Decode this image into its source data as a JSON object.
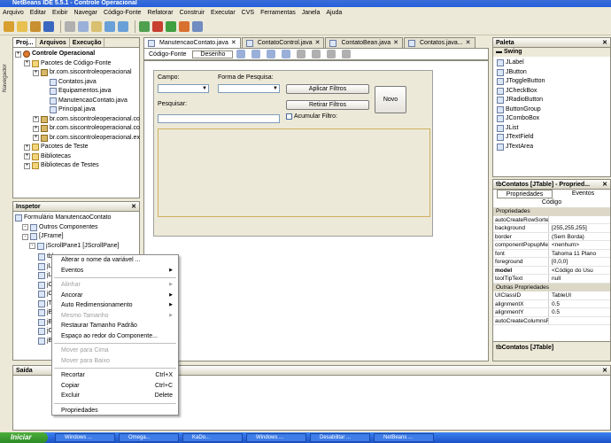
{
  "window": {
    "title": "NetBeans IDE 5.5.1 - Controle Operacional"
  },
  "menu": [
    "Arquivo",
    "Editar",
    "Exibir",
    "Navegar",
    "Código-Fonte",
    "Refatorar",
    "Construir",
    "Executar",
    "CVS",
    "Ferramentas",
    "Janela",
    "Ajuda"
  ],
  "left_tabs": [
    "Proj...",
    "Arquivos",
    "Execução"
  ],
  "navigator_label": "Navegador",
  "project_tree": [
    {
      "label": "Controle Operacional",
      "level": 0,
      "icon": "proj",
      "bold": true
    },
    {
      "label": "Pacotes de Código-Fonte",
      "level": 1,
      "icon": "fold"
    },
    {
      "label": "br.com.siscontroleoperacional",
      "level": 2,
      "icon": "pkg"
    },
    {
      "label": "Contatos.java",
      "level": 3,
      "icon": "file"
    },
    {
      "label": "Equipamentos.java",
      "level": 3,
      "icon": "file"
    },
    {
      "label": "ManutencaoContato.java",
      "level": 3,
      "icon": "file"
    },
    {
      "label": "Principal.java",
      "level": 3,
      "icon": "file"
    },
    {
      "label": "br.com.siscontroleoperacional.co",
      "level": 2,
      "icon": "pkg"
    },
    {
      "label": "br.com.siscontroleoperacional.co",
      "level": 2,
      "icon": "pkg"
    },
    {
      "label": "br.com.siscontroleoperacional.ex",
      "level": 2,
      "icon": "pkg"
    },
    {
      "label": "Pacotes de Teste",
      "level": 1,
      "icon": "fold"
    },
    {
      "label": "Bibliotecas",
      "level": 1,
      "icon": "fold"
    },
    {
      "label": "Bibliotecas de Testes",
      "level": 1,
      "icon": "fold"
    }
  ],
  "inspector": {
    "title": "Inspetor",
    "items": [
      {
        "label": "Formulário ManutencaoContato",
        "level": 0
      },
      {
        "label": "Outros Componentes",
        "level": 1
      },
      {
        "label": "[JFrame]",
        "level": 1
      },
      {
        "label": "jScrollPane1 [JScrollPane]",
        "level": 2
      }
    ]
  },
  "editor_tabs": [
    "ManutencaoContato.java",
    "ContatoControl.java",
    "ContatoBean.java",
    "Contatos.java..."
  ],
  "editor_mode": {
    "source": "Código-Fonte",
    "design": "Desenho"
  },
  "form": {
    "campo_label": "Campo:",
    "forma_label": "Forma de Pesquisa:",
    "pesquisar_label": "Pesquisar:",
    "aplicar": "Aplicar Filtros",
    "retirar": "Retirar Filtros",
    "novo": "Novo",
    "acumular": "Acumular Filtro:"
  },
  "context_menu": [
    {
      "label": "Alterar o nome da variável ...",
      "enabled": true
    },
    {
      "label": "Eventos",
      "enabled": true,
      "submenu": true
    },
    {
      "sep": true
    },
    {
      "label": "Alinhar",
      "enabled": false,
      "submenu": true
    },
    {
      "label": "Ancorar",
      "enabled": true,
      "submenu": true
    },
    {
      "label": "Auto Redimensionamento",
      "enabled": true,
      "submenu": true
    },
    {
      "label": "Mesmo Tamanho",
      "enabled": false,
      "submenu": true
    },
    {
      "label": "Restaurar Tamanho Padrão",
      "enabled": true
    },
    {
      "label": "Espaço ao redor do Componente...",
      "enabled": true
    },
    {
      "sep": true
    },
    {
      "label": "Mover para Cima",
      "enabled": false
    },
    {
      "label": "Mover para Baixo",
      "enabled": false
    },
    {
      "sep": true
    },
    {
      "label": "Recortar",
      "shortcut": "Ctrl+X",
      "enabled": true
    },
    {
      "label": "Copiar",
      "shortcut": "Ctrl+C",
      "enabled": true
    },
    {
      "label": "Excluir",
      "shortcut": "Delete",
      "enabled": true
    },
    {
      "sep": true
    },
    {
      "label": "Propriedades",
      "enabled": true
    }
  ],
  "palette": {
    "title": "Paleta",
    "category": "Swing",
    "items": [
      "JLabel",
      "JButton",
      "JToggleButton",
      "JCheckBox",
      "JRadioButton",
      "ButtonGroup",
      "JComboBox",
      "JList",
      "JTextField",
      "JTextArea"
    ]
  },
  "properties": {
    "title": "tbContatos [JTable] - Propried...",
    "tabs": [
      "Propriedades",
      "Eventos"
    ],
    "subtab": "Código",
    "category1": "Propriedades",
    "rows": [
      {
        "k": "autoCreateRowSorte",
        "v": ""
      },
      {
        "k": "background",
        "v": "[255,255,255]"
      },
      {
        "k": "border",
        "v": "(Sem Borda)"
      },
      {
        "k": "componentPopupMe",
        "v": "<nenhum>"
      },
      {
        "k": "font",
        "v": "Tahoma 11 Plano"
      },
      {
        "k": "foreground",
        "v": "[0,0,0]"
      },
      {
        "k": "model",
        "v": "<Código do Usu",
        "bold": true
      },
      {
        "k": "toolTipText",
        "v": "null"
      }
    ],
    "category2": "Outras Propriedades",
    "rows2": [
      {
        "k": "UIClassID",
        "v": "TableUI"
      },
      {
        "k": "alignmentX",
        "v": "0.5"
      },
      {
        "k": "alignmentY",
        "v": "0.5"
      },
      {
        "k": "autoCreateColumnsF",
        "v": ""
      }
    ],
    "footer": "tbContatos [JTable]"
  },
  "output": {
    "title": "Saída"
  },
  "taskbar": {
    "start": "Iniciar",
    "tasks": [
      "Windows ...",
      "Òmega...",
      "KaDo...",
      "Windows ...",
      "Desabilitar ...",
      "NetBeans ..."
    ]
  }
}
